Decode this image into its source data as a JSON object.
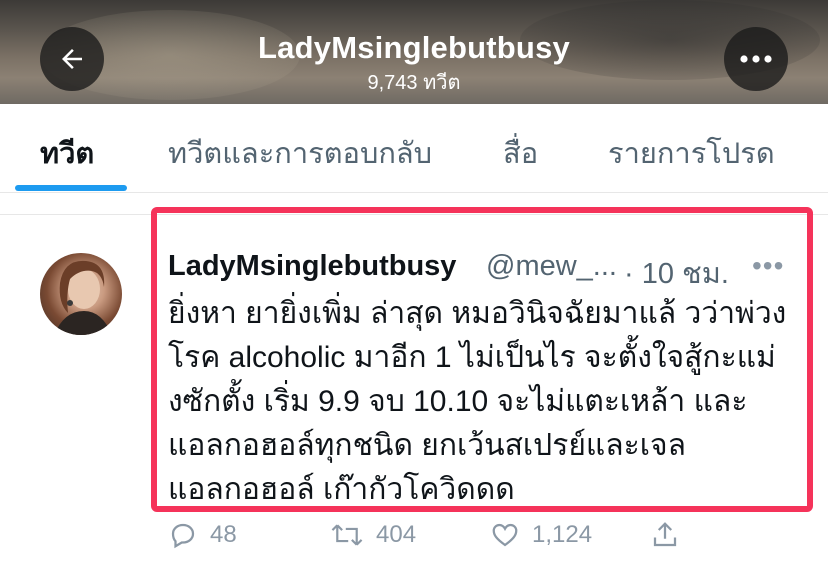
{
  "header": {
    "title": "LadyMsinglebutbusy",
    "tweet_count": "9,743 ทวีต",
    "back_icon": "arrow-left-icon",
    "more_icon": "more-horizontal-icon"
  },
  "tabs": [
    {
      "label": "ทวีต",
      "active": true
    },
    {
      "label": "ทวีตและการตอบกลับ",
      "active": false
    },
    {
      "label": "สื่อ",
      "active": false
    },
    {
      "label": "รายการโปรด",
      "active": false
    }
  ],
  "tweet": {
    "display_name": "LadyMsinglebutbusy",
    "handle": "@mew_...",
    "time": "· 10 ชม.",
    "lines": [
      "ยิ่งหา ยายิ่งเพิ่ม ล่าสุด หมอวินิจฉัยมาแล้ วว่าพ่วง",
      "โรค alcoholic มาอีก 1 ไม่เป็นไร จะตั้งใจสู้กะแม่",
      "งซักตั้ง เริ่ม 9.9 จบ 10.10 จะไม่แตะเหล้า และ",
      "แอลกอฮอล์ทุกชนิด ยกเว้นสเปรย์และเจล",
      "แอลกอฮอล์ เก๊ากัวโควิดดด"
    ],
    "actions": {
      "replies": "48",
      "retweets": "404",
      "likes": "1,124"
    }
  },
  "colors": {
    "accent": "#1d9bf0",
    "highlight_border": "#f5335a",
    "secondary_text": "#536471"
  }
}
